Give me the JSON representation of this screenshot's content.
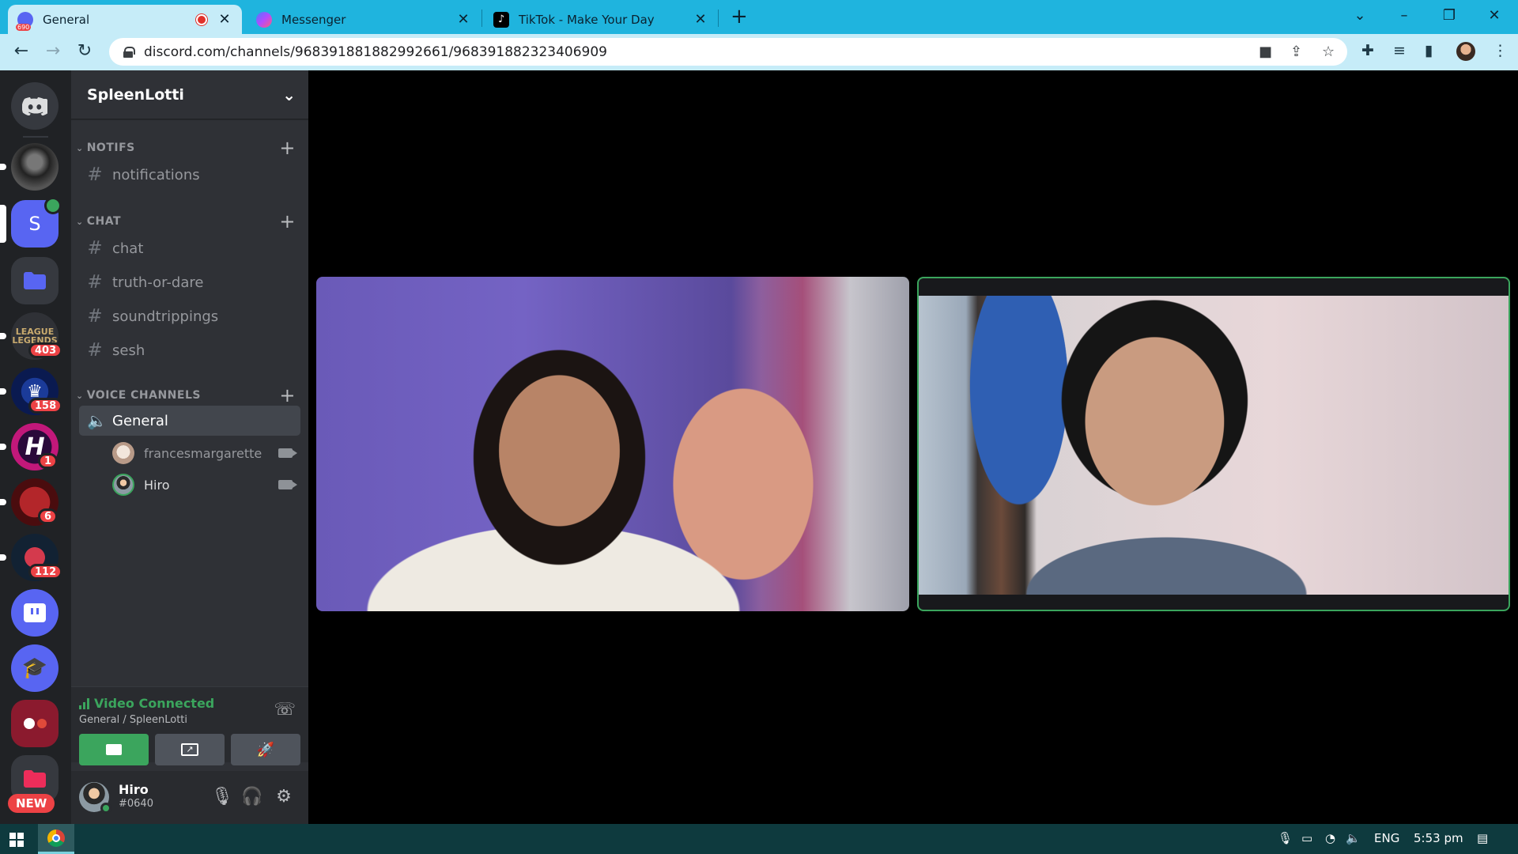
{
  "browser": {
    "tabs": [
      {
        "title": "General",
        "badge": "690",
        "recording": true
      },
      {
        "title": "Messenger"
      },
      {
        "title": "TikTok - Make Your Day"
      }
    ],
    "url": "discord.com/channels/968391881882992661/968391882323406909",
    "window_controls": {
      "minimize": "–",
      "restore": "❐",
      "close": "✕",
      "tab_search": "⌄"
    }
  },
  "guilds": {
    "badges": [
      "403",
      "158",
      "1",
      "6",
      "112"
    ],
    "selected_initial": "S",
    "league_text": "LEAGUE\nLEGENDS",
    "new_label": "NEW"
  },
  "server": {
    "name": "SpleenLotti",
    "categories": [
      {
        "label": "NOTIFS",
        "channels": [
          "notifications"
        ]
      },
      {
        "label": "CHAT",
        "channels": [
          "chat",
          "truth-or-dare",
          "soundtrippings",
          "sesh"
        ]
      },
      {
        "label": "VOICE CHANNELS",
        "channels": [
          "General"
        ]
      }
    ],
    "voice_users": [
      {
        "name": "francesmargarette"
      },
      {
        "name": "Hiro"
      }
    ]
  },
  "voice": {
    "status": "Video Connected",
    "location": "General / SpleenLotti"
  },
  "user": {
    "name": "Hiro",
    "tag": "#0640"
  },
  "taskbar": {
    "lang": "ENG",
    "time": "5:53 pm"
  },
  "colors": {
    "accent_green": "#3ba55d",
    "blurple": "#5865f2",
    "badge_red": "#ed4245",
    "chrome_blue": "#1fb4de"
  }
}
